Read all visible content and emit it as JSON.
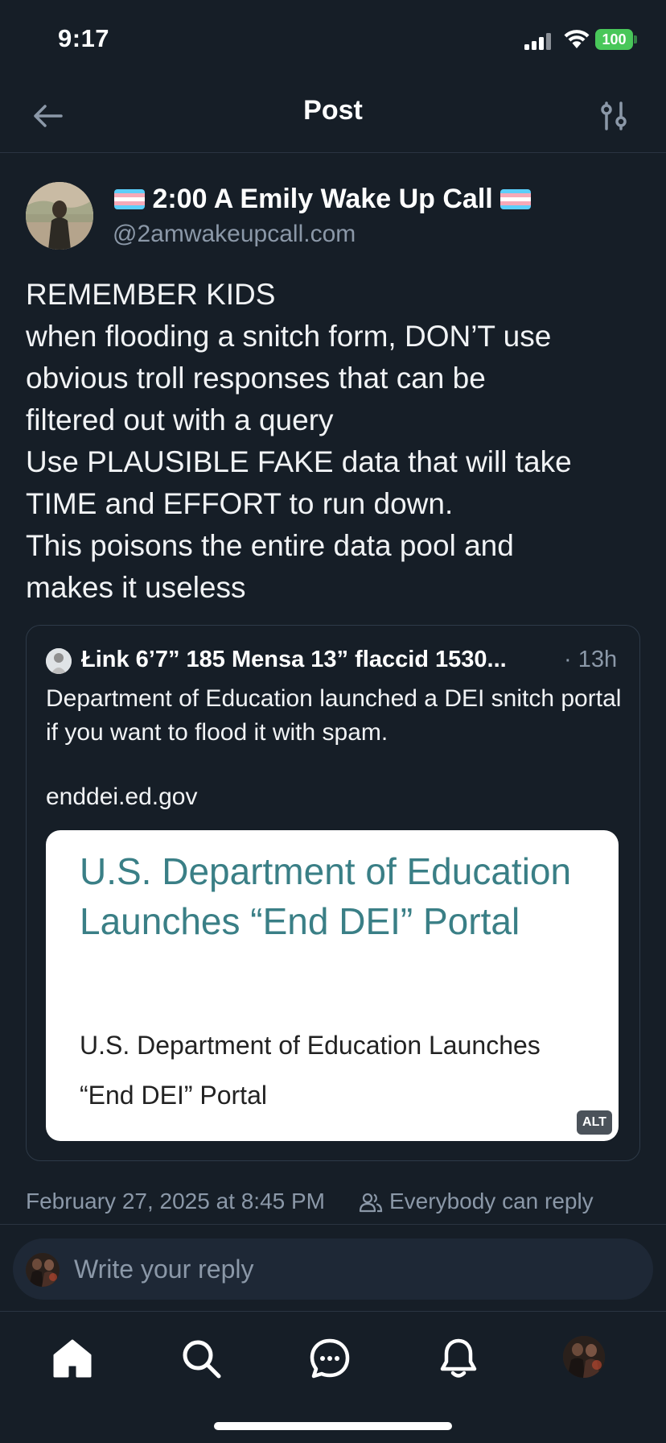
{
  "status_bar": {
    "time": "9:17",
    "battery": "100"
  },
  "header": {
    "title": "Post"
  },
  "post": {
    "author_name": "2:00 A Emily Wake Up Call",
    "author_handle": "@2amwakeupcall.com",
    "body_lines": [
      "REMEMBER KIDS",
      "when flooding a snitch form, DON’T use",
      "obvious troll responses that can be",
      "filtered out with a query",
      "Use PLAUSIBLE FAKE data that will take",
      "TIME and EFFORT to run down.",
      "This poisons the entire data pool and",
      "makes it useless"
    ],
    "quote": {
      "author": "Łink 6’7” 185 Mensa 13” flaccid 1530...",
      "time": "· 13h",
      "text": "Department of Education launched a DEI snitch portal if you want to flood it with spam.",
      "link_text": "enddei.ed.gov",
      "card_title": "U.S. Department of Education Launches “End DEI” Portal",
      "card_subtitle": "U.S. Department of Education Launches “End DEI” Portal",
      "alt_label": "ALT"
    },
    "timestamp": "February 27, 2025 at 8:45 PM",
    "reply_setting": "Everybody can reply"
  },
  "reply_bar": {
    "placeholder": "Write your reply"
  },
  "tab_bar": {
    "items": [
      "home-icon",
      "search-icon",
      "chat-icon",
      "bell-icon",
      "profile-avatar"
    ]
  },
  "colors": {
    "background": "#161e27",
    "secondary_text": "#8b98a8",
    "link_card_title": "#3a7f86",
    "battery": "#49c75a"
  }
}
